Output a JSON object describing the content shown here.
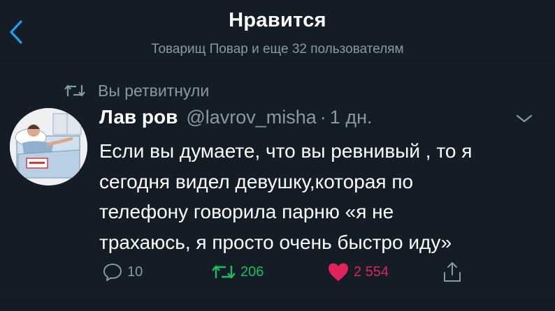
{
  "header": {
    "title": "Нравится",
    "subtitle": "Товарищ Повар и еще 32 пользователям"
  },
  "retweet_indicator": {
    "label": "Вы ретвитнули"
  },
  "tweet": {
    "display_name": "Лав ров",
    "handle": "@lavrov_misha",
    "separator": "·",
    "time": "1 дн.",
    "text_lines": [
      "Если вы думаете, что вы ревнивый , то я",
      "сегодня видел девушку,которая по",
      "телефону говорила парню «я не",
      "трахаюсь, я просто очень быстро иду»"
    ],
    "actions": {
      "reply_count": "10",
      "retweet_count": "206",
      "like_count": "2 554"
    }
  },
  "colors": {
    "background": "#141d26",
    "accent_blue": "#1da1f2",
    "secondary_text": "#8899a6",
    "retweet_green": "#17bf63",
    "like_red": "#e0245e"
  },
  "icons": {
    "back": "chevron-left-icon",
    "retweet": "retweet-icon",
    "caret": "chevron-down-icon",
    "reply": "reply-icon",
    "like": "heart-icon",
    "share": "share-icon"
  }
}
